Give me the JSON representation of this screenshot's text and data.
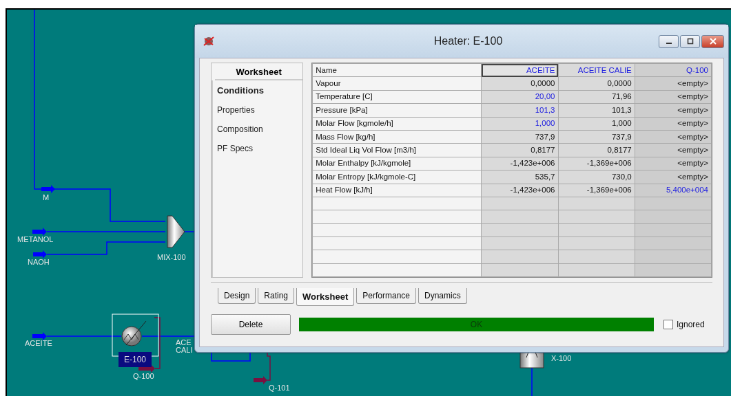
{
  "flowsheet": {
    "labels": [
      {
        "text": "M",
        "kind": "stream"
      },
      {
        "text": "METANOL",
        "kind": "stream"
      },
      {
        "text": "NAOH",
        "kind": "stream"
      },
      {
        "text": "MIX-100",
        "kind": "unit"
      },
      {
        "text": "ACEITE",
        "kind": "stream"
      },
      {
        "text": "E-100",
        "kind": "selected-unit"
      },
      {
        "text": "Q-100",
        "kind": "stream"
      },
      {
        "text": "ACE",
        "kind": "stream"
      },
      {
        "text": "CALI",
        "kind": "stream"
      },
      {
        "text": "Q-101",
        "kind": "stream"
      },
      {
        "text": "X-100",
        "kind": "unit"
      }
    ]
  },
  "window": {
    "title": "Heater: E-100",
    "sidebar": {
      "title": "Worksheet",
      "items": [
        {
          "label": "Conditions",
          "selected": true
        },
        {
          "label": "Properties",
          "selected": false
        },
        {
          "label": "Composition",
          "selected": false
        },
        {
          "label": "PF Specs",
          "selected": false
        }
      ]
    },
    "table": {
      "columns": [
        {
          "text": "Name",
          "selected": false
        },
        {
          "text": "ACEITE",
          "selected": true
        },
        {
          "text": "ACEITE CALIE",
          "selected": false
        },
        {
          "text": "Q-100",
          "selected": false
        }
      ],
      "rows": [
        [
          {
            "text": "Vapour"
          },
          {
            "text": "0,0000",
            "specified": false
          },
          {
            "text": "0,0000",
            "specified": false
          },
          {
            "text": "<empty>",
            "specified": false
          }
        ],
        [
          {
            "text": "Temperature [C]"
          },
          {
            "text": "20,00",
            "specified": true
          },
          {
            "text": "71,96",
            "specified": false
          },
          {
            "text": "<empty>",
            "specified": false
          }
        ],
        [
          {
            "text": "Pressure [kPa]"
          },
          {
            "text": "101,3",
            "specified": true
          },
          {
            "text": "101,3",
            "specified": false
          },
          {
            "text": "<empty>",
            "specified": false
          }
        ],
        [
          {
            "text": "Molar Flow [kgmole/h]"
          },
          {
            "text": "1,000",
            "specified": true
          },
          {
            "text": "1,000",
            "specified": false
          },
          {
            "text": "<empty>",
            "specified": false
          }
        ],
        [
          {
            "text": "Mass Flow [kg/h]"
          },
          {
            "text": "737,9",
            "specified": false
          },
          {
            "text": "737,9",
            "specified": false
          },
          {
            "text": "<empty>",
            "specified": false
          }
        ],
        [
          {
            "text": "Std Ideal Liq Vol Flow [m3/h]"
          },
          {
            "text": "0,8177",
            "specified": false
          },
          {
            "text": "0,8177",
            "specified": false
          },
          {
            "text": "<empty>",
            "specified": false
          }
        ],
        [
          {
            "text": "Molar Enthalpy [kJ/kgmole]"
          },
          {
            "text": "-1,423e+006",
            "specified": false
          },
          {
            "text": "-1,369e+006",
            "specified": false
          },
          {
            "text": "<empty>",
            "specified": false
          }
        ],
        [
          {
            "text": "Molar Entropy [kJ/kgmole-C]"
          },
          {
            "text": "535,7",
            "specified": false
          },
          {
            "text": "730,0",
            "specified": false
          },
          {
            "text": "<empty>",
            "specified": false
          }
        ],
        [
          {
            "text": "Heat Flow [kJ/h]"
          },
          {
            "text": "-1,423e+006",
            "specified": false
          },
          {
            "text": "-1,369e+006",
            "specified": false
          },
          {
            "text": "5,400e+004",
            "specified": true
          }
        ]
      ]
    },
    "tabs": [
      {
        "label": "Design",
        "selected": false
      },
      {
        "label": "Rating",
        "selected": false
      },
      {
        "label": "Worksheet",
        "selected": true
      },
      {
        "label": "Performance",
        "selected": false
      },
      {
        "label": "Dynamics",
        "selected": false
      }
    ],
    "delete_button": "Delete",
    "status": {
      "text": "OK",
      "color": "#008000"
    },
    "ignored": {
      "label": "Ignored",
      "checked": false
    }
  }
}
